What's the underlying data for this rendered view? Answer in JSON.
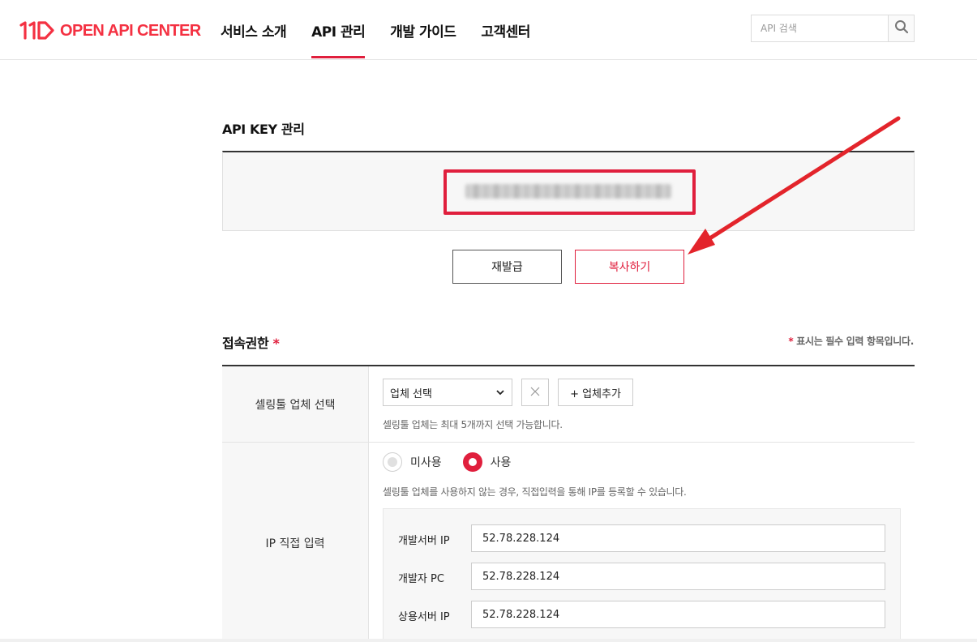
{
  "header": {
    "logo_text": "OPEN API CENTER",
    "nav": [
      "서비스 소개",
      "API 관리",
      "개발 가이드",
      "고객센터"
    ],
    "search_placeholder": "API 검색"
  },
  "api_key": {
    "title": "API KEY 관리",
    "reissue_label": "재발급",
    "copy_label": "복사하기"
  },
  "access": {
    "title": "접속권한",
    "required_mark": "*",
    "required_note_star": "*",
    "required_note": "표시는 필수 입력 항목입니다.",
    "seller_tool": {
      "label": "셀링툴 업체 선택",
      "select_value": "업체 선택",
      "add_label": "+ 업체추가",
      "help": "셀링툴 업체는 최대 5개까지 선택 가능합니다."
    },
    "ip_direct": {
      "label": "IP 직접 입력",
      "option_unused": "미사용",
      "option_used": "사용",
      "help": "셀링툴 업체를 사용하지 않는 경우, 직접입력을 통해 IP를 등록할 수 있습니다.",
      "rows": [
        {
          "label": "개발서버 IP",
          "value": "52.78.228.124"
        },
        {
          "label": "개발자 PC",
          "value": "52.78.228.124"
        },
        {
          "label": "상용서버 IP",
          "value": "52.78.228.124"
        }
      ]
    }
  },
  "colors": {
    "brand_red": "#e01f3d",
    "annotation_red": "#e3242b"
  }
}
